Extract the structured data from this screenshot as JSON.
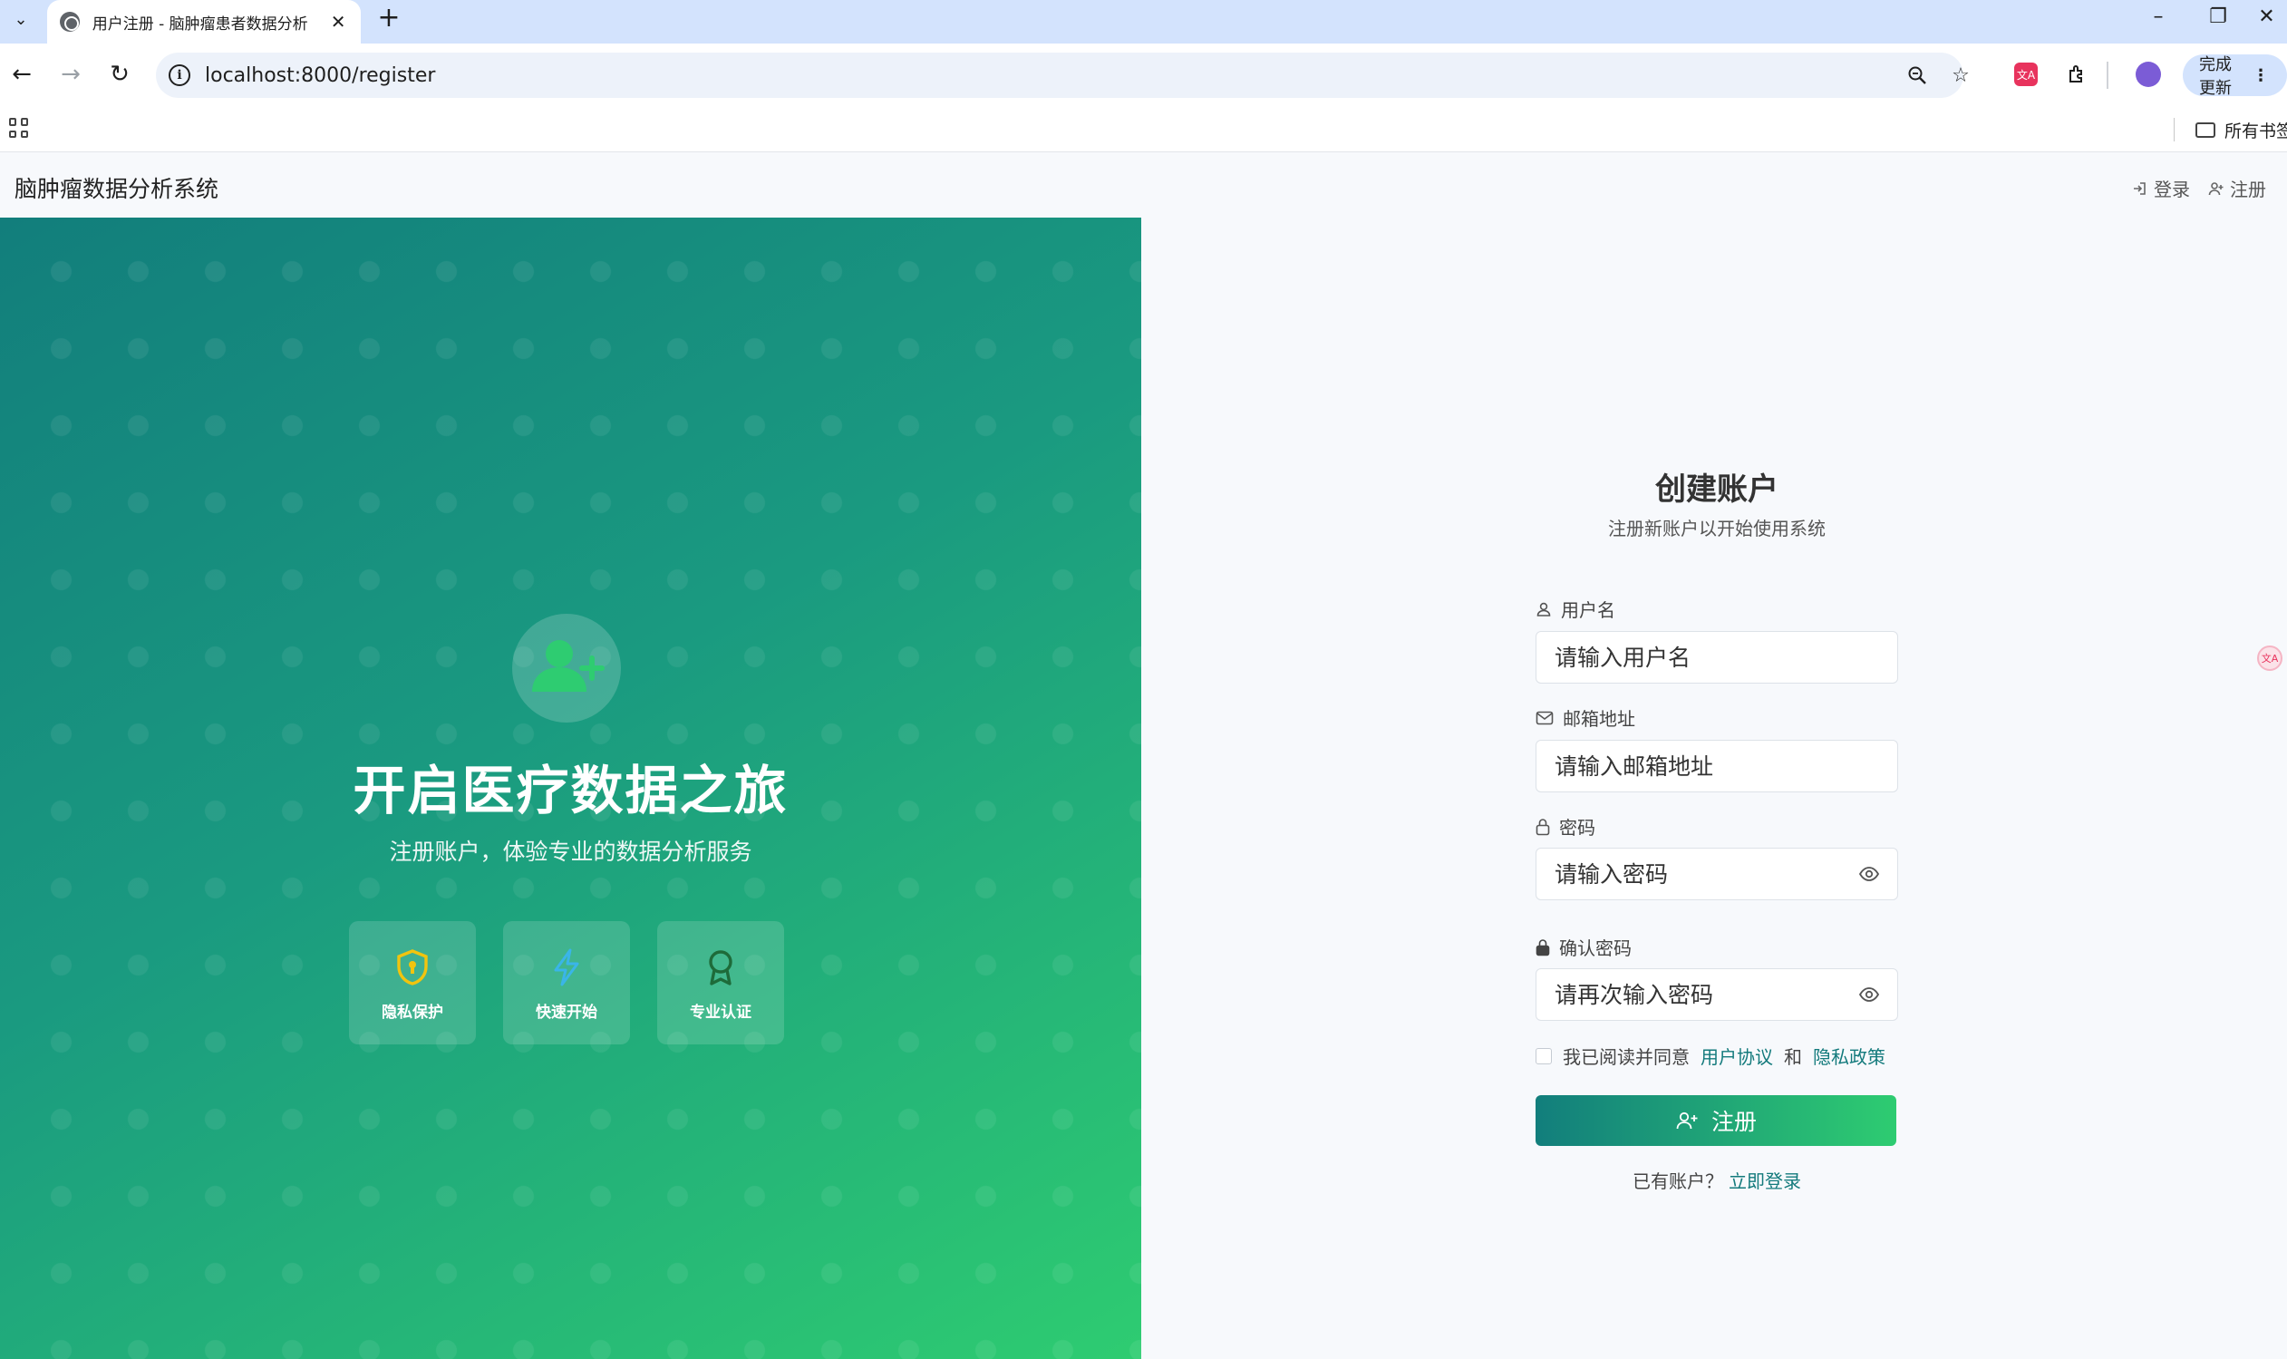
{
  "browser": {
    "tab_title": "用户注册 - 脑肿瘤患者数据分析",
    "url": "localhost:8000/register",
    "update_label": "完成更新",
    "bookmarks_folder": "所有书签",
    "translate_glyph": "文A"
  },
  "header": {
    "app_title": "脑肿瘤数据分析系统",
    "login_link": "登录",
    "register_link": "注册"
  },
  "hero": {
    "title": "开启医疗数据之旅",
    "subtitle": "注册账户，体验专业的数据分析服务",
    "features": [
      {
        "label": "隐私保护",
        "icon": "shield-icon",
        "color": "#f1c40f"
      },
      {
        "label": "快速开始",
        "icon": "lightning-icon",
        "color": "#3ab5e8"
      },
      {
        "label": "专业认证",
        "icon": "award-icon",
        "color": "#1e6b3a"
      }
    ]
  },
  "form": {
    "title": "创建账户",
    "subtitle": "注册新账户以开始使用系统",
    "username": {
      "label": "用户名",
      "placeholder": "请输入用户名",
      "value": ""
    },
    "email": {
      "label": "邮箱地址",
      "placeholder": "请输入邮箱地址",
      "value": ""
    },
    "password": {
      "label": "密码",
      "placeholder": "请输入密码",
      "value": ""
    },
    "confirm_password": {
      "label": "确认密码",
      "placeholder": "请再次输入密码",
      "value": ""
    },
    "agree": {
      "prefix": "我已阅读并同意",
      "terms_link": "用户协议",
      "joiner": "和",
      "privacy_link": "隐私政策",
      "checked": false
    },
    "submit_label": "注册",
    "login_prompt": "已有账户？",
    "login_link": "立即登录"
  },
  "colors": {
    "primary": "#127e7c",
    "accent": "#2ecc71",
    "link": "#137a7c"
  }
}
